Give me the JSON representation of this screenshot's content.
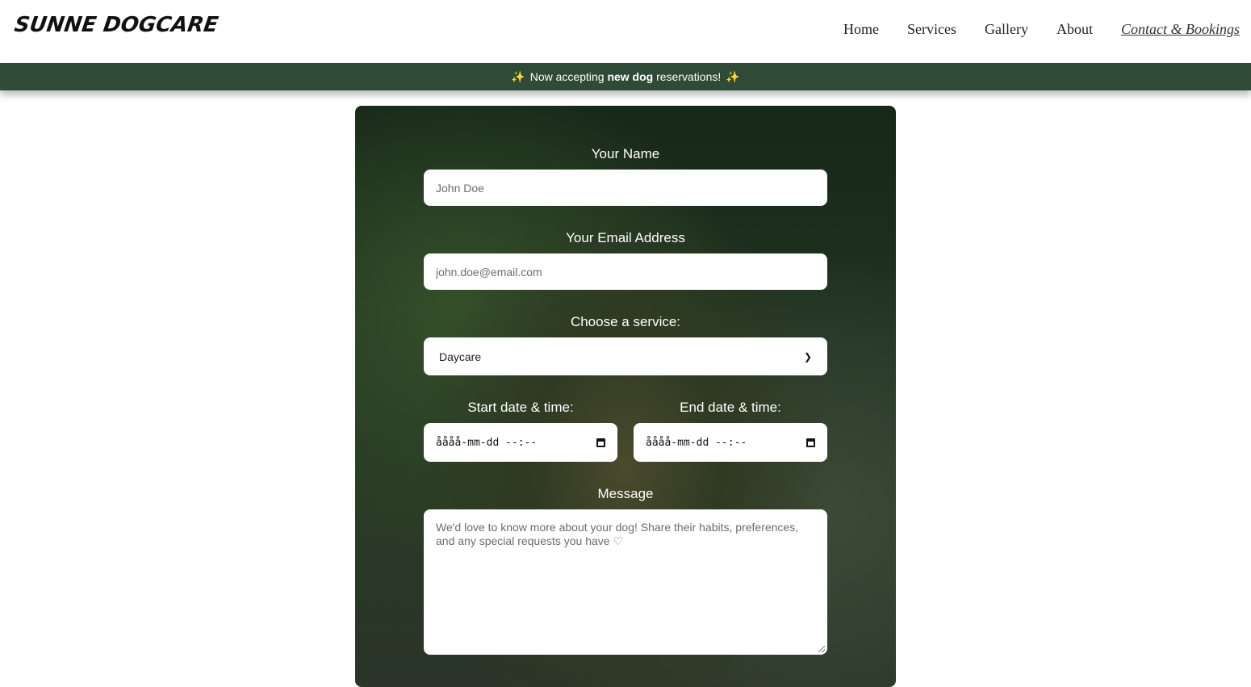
{
  "brand": {
    "logo_text": "SUNNE DOGCARE"
  },
  "nav": [
    {
      "label": "Home"
    },
    {
      "label": "Services"
    },
    {
      "label": "Gallery"
    },
    {
      "label": "About"
    },
    {
      "label": "Contact & Bookings"
    }
  ],
  "banner": {
    "prefix": "Now accepting",
    "highlight": "new dog",
    "suffix": "reservations!",
    "icon": "sparkles-icon"
  },
  "form": {
    "name_label": "Your Name",
    "name_placeholder": "John Doe",
    "email_label": "Your Email Address",
    "email_placeholder": "john.doe@email.com",
    "service_label": "Choose a service:",
    "service_selected": "Daycare",
    "start_label": "Start date & time:",
    "start_value": "åååå-mm-dd --:--",
    "end_label": "End date & time:",
    "end_value": "åååå-mm-dd --:--",
    "message_label": "Message",
    "message_placeholder": "We'd love to know more about your dog! Share their habits, preferences, and any special requests you have ♡"
  },
  "colors": {
    "banner_bg": "#2f4a36",
    "card_bg": "#1f301f"
  }
}
